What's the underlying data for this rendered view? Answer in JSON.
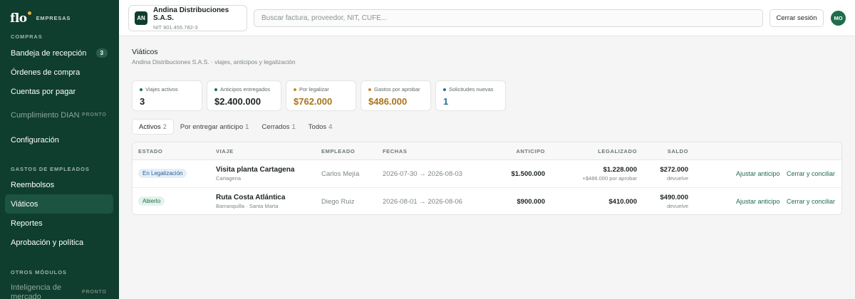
{
  "brand": {
    "logo": "flo",
    "tag": "EMPRESAS"
  },
  "sidebar": {
    "sections": [
      {
        "title": "COMPRAS"
      },
      {
        "title": "GASTOS DE EMPLEADOS"
      },
      {
        "title": "OTROS MÓDULOS"
      }
    ],
    "items": [
      {
        "label": "Bandeja de recepción",
        "badge": "3"
      },
      {
        "label": "Órdenes de compra"
      },
      {
        "label": "Cuentas por pagar"
      },
      {
        "label": "Cumplimiento DIAN",
        "tag": "PRONTO"
      },
      {
        "label": "Configuración"
      },
      {
        "label": "Reembolsos"
      },
      {
        "label": "Viáticos"
      },
      {
        "label": "Reportes"
      },
      {
        "label": "Aprobación y política"
      },
      {
        "label": "Inteligencia de mercado",
        "tag": "PRONTO"
      }
    ],
    "active_item": "Viáticos"
  },
  "topbar": {
    "company_initials": "AN",
    "company_name": "Andina Distribuciones S.A.S.",
    "company_nit": "NIT 901.455.782-3",
    "search_placeholder": "Buscar factura, proveedor, NIT, CUFE...",
    "logout_label": "Cerrar sesión",
    "user_initials": "MO"
  },
  "page": {
    "title": "Viáticos",
    "subtitle": "Andina Distribuciones S.A.S. · viajes, anticipos y legalización"
  },
  "stats": [
    {
      "label": "Viajes activos",
      "value": "3",
      "dot_color": "#1f6d4c",
      "value_color": "#1c2420"
    },
    {
      "label": "Anticipos entregados",
      "value": "$2.400.000",
      "dot_color": "#1f6d4c",
      "value_color": "#1c2420"
    },
    {
      "label": "Por legalizar",
      "value": "$762.000",
      "dot_color": "#c98a1e",
      "value_color": "#a8741a"
    },
    {
      "label": "Gastos por aprobar",
      "value": "$486.000",
      "dot_color": "#c98a1e",
      "value_color": "#a8741a"
    },
    {
      "label": "Solicitudes nuevas",
      "value": "1",
      "dot_color": "#2a6f96",
      "value_color": "#2a6f96"
    }
  ],
  "tabs": [
    {
      "label": "Activos",
      "count": "2"
    },
    {
      "label": "Por entregar anticipo",
      "count": "1"
    },
    {
      "label": "Cerrados",
      "count": "1"
    },
    {
      "label": "Todos",
      "count": "4"
    }
  ],
  "active_tab": "Activos",
  "table": {
    "headers": {
      "estado": "ESTADO",
      "viaje": "VIAJE",
      "empleado": "EMPLEADO",
      "fechas": "FECHAS",
      "anticipo": "ANTICIPO",
      "legalizado": "LEGALIZADO",
      "saldo": "SALDO"
    },
    "rows": [
      {
        "estado": "En Legalización",
        "viaje": "Visita planta Cartagena",
        "destino": "Cartagena",
        "empleado": "Carlos Mejía",
        "fechas": "2026-07-30 → 2026-08-03",
        "anticipo": "$1.500.000",
        "legalizado": "$1.228.000",
        "legalizado_nota": "+$486.000 por aprobar",
        "saldo": "$272.000",
        "saldo_nota": "devuelve",
        "accion_1": "Ajustar anticipo",
        "accion_2": "Cerrar y conciliar"
      },
      {
        "estado": "Abierto",
        "viaje": "Ruta Costa Atlántica",
        "destino": "Barranquilla · Santa Marta",
        "empleado": "Diego Ruiz",
        "fechas": "2026-08-01 → 2026-08-06",
        "anticipo": "$900.000",
        "legalizado": "$410.000",
        "saldo": "$490.000",
        "saldo_nota": "devuelve",
        "accion_1": "Ajustar anticipo",
        "accion_2": "Cerrar y conciliar"
      }
    ]
  }
}
